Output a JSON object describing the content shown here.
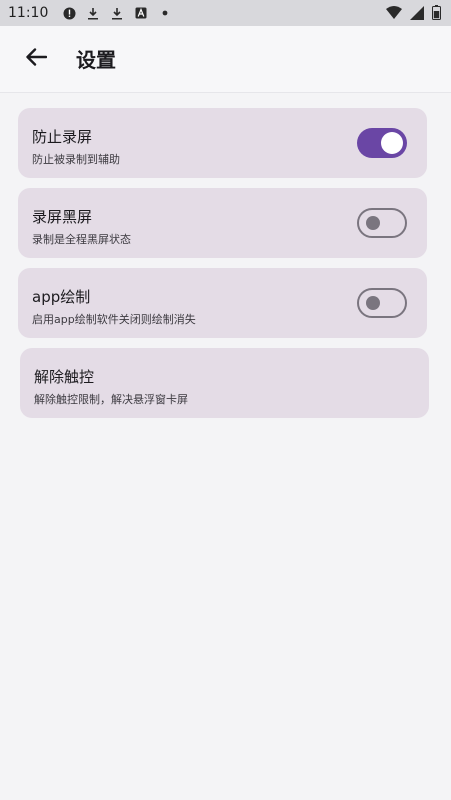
{
  "status_bar": {
    "time": "11:10",
    "left_icons": [
      "alert-icon",
      "download-icon",
      "download-icon",
      "font-icon",
      "dot-icon"
    ],
    "right_icons": [
      "wifi-icon",
      "signal-icon",
      "battery-icon"
    ]
  },
  "app_bar": {
    "back_icon": "arrow-left-icon",
    "title": "设置"
  },
  "settings": [
    {
      "label": "防止录屏",
      "description": "防止被录制到辅助",
      "toggle": true
    },
    {
      "label": "录屏黑屏",
      "description": "录制是全程黑屏状态",
      "toggle": false
    },
    {
      "label": "app绘制",
      "description": "启用app绘制软件关闭则绘制消失",
      "toggle": false
    },
    {
      "label": "解除触控",
      "description": "解除触控限制，解决悬浮窗卡屏"
    }
  ],
  "colors": {
    "accent": "#6a46a5",
    "card_bg": "#e4dce6",
    "page_bg": "#f4f4f6"
  }
}
